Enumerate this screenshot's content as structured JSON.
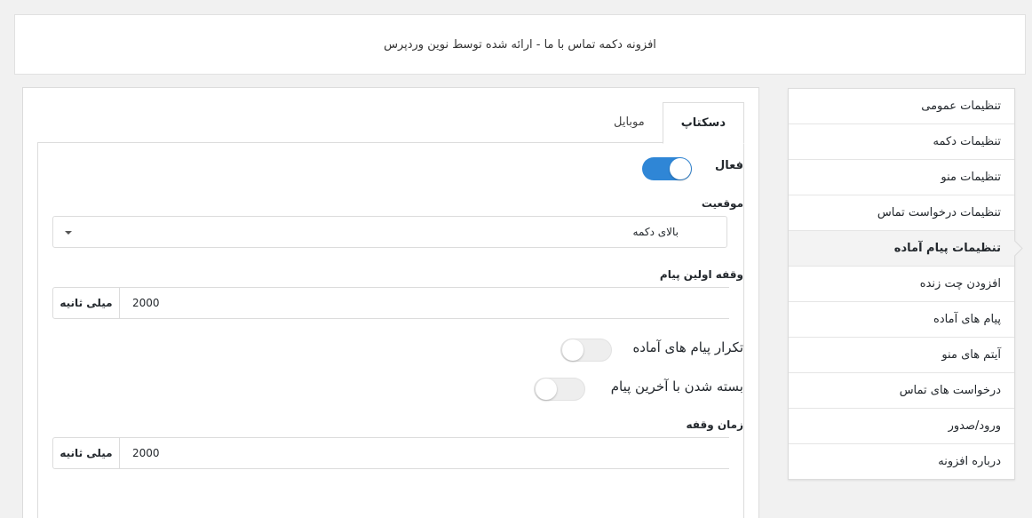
{
  "header": {
    "title": "افزونه دکمه تماس با ما - ارائه شده توسط نوین وردپرس"
  },
  "sidebar": {
    "items": [
      {
        "label": "تنظیمات عمومی"
      },
      {
        "label": "تنظیمات دکمه"
      },
      {
        "label": "تنظیمات منو"
      },
      {
        "label": "تنظیمات درخواست تماس"
      },
      {
        "label": "تنظیمات پیام آماده",
        "active": true
      },
      {
        "label": "افزودن چت زنده"
      },
      {
        "label": "پیام های آماده"
      },
      {
        "label": "آیتم های منو"
      },
      {
        "label": "درخواست های تماس"
      },
      {
        "label": "ورود/صدور"
      },
      {
        "label": "درباره افزونه"
      }
    ]
  },
  "tabs": [
    {
      "label": "دسکتاپ",
      "active": true
    },
    {
      "label": "موبایل",
      "active": false
    }
  ],
  "form": {
    "enabled": {
      "label": "فعال",
      "value": true
    },
    "position": {
      "label": "موقعیت",
      "value": "بالای دکمه"
    },
    "first_message_delay": {
      "label": "وقفه اولین پیام",
      "value": "2000",
      "unit": "میلی ثانیه"
    },
    "repeat_messages": {
      "label": "تکرار پیام های آماده",
      "value": false
    },
    "close_on_last": {
      "label": "بسته شدن با آخرین پیام",
      "value": false
    },
    "delay_time": {
      "label": "زمان وقفه",
      "value": "2000",
      "unit": "میلی ثانیه"
    }
  },
  "colors": {
    "accent": "#2f86d6",
    "background": "#f1f1f1"
  }
}
